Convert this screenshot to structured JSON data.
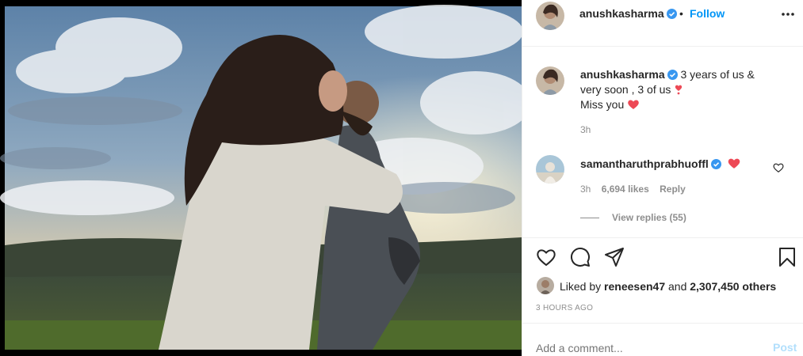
{
  "post": {
    "author": "anushkasharma",
    "follow_label": "Follow",
    "separator": "•",
    "caption": {
      "line1": "3 years of us &",
      "line2": "very soon , 3 of us",
      "line3": "Miss you",
      "time": "3h"
    },
    "comment": {
      "username": "samantharuthprabhuoffl",
      "time": "3h",
      "likes": "6,694 likes",
      "reply_label": "Reply"
    },
    "view_replies": "View replies (55)",
    "liked_by": {
      "prefix": "Liked by ",
      "user": "reneesen47",
      "middle": " and ",
      "others": "2,307,450 others"
    },
    "posted_ago": "3 HOURS AGO",
    "add_comment_placeholder": "Add a comment...",
    "post_label": "Post"
  },
  "colors": {
    "link_blue": "#0095f6",
    "post_disabled": "#b2dffc",
    "verified": "#3897f0",
    "heart_red": "#ed4956",
    "secondary_text": "#8e8e8e"
  }
}
